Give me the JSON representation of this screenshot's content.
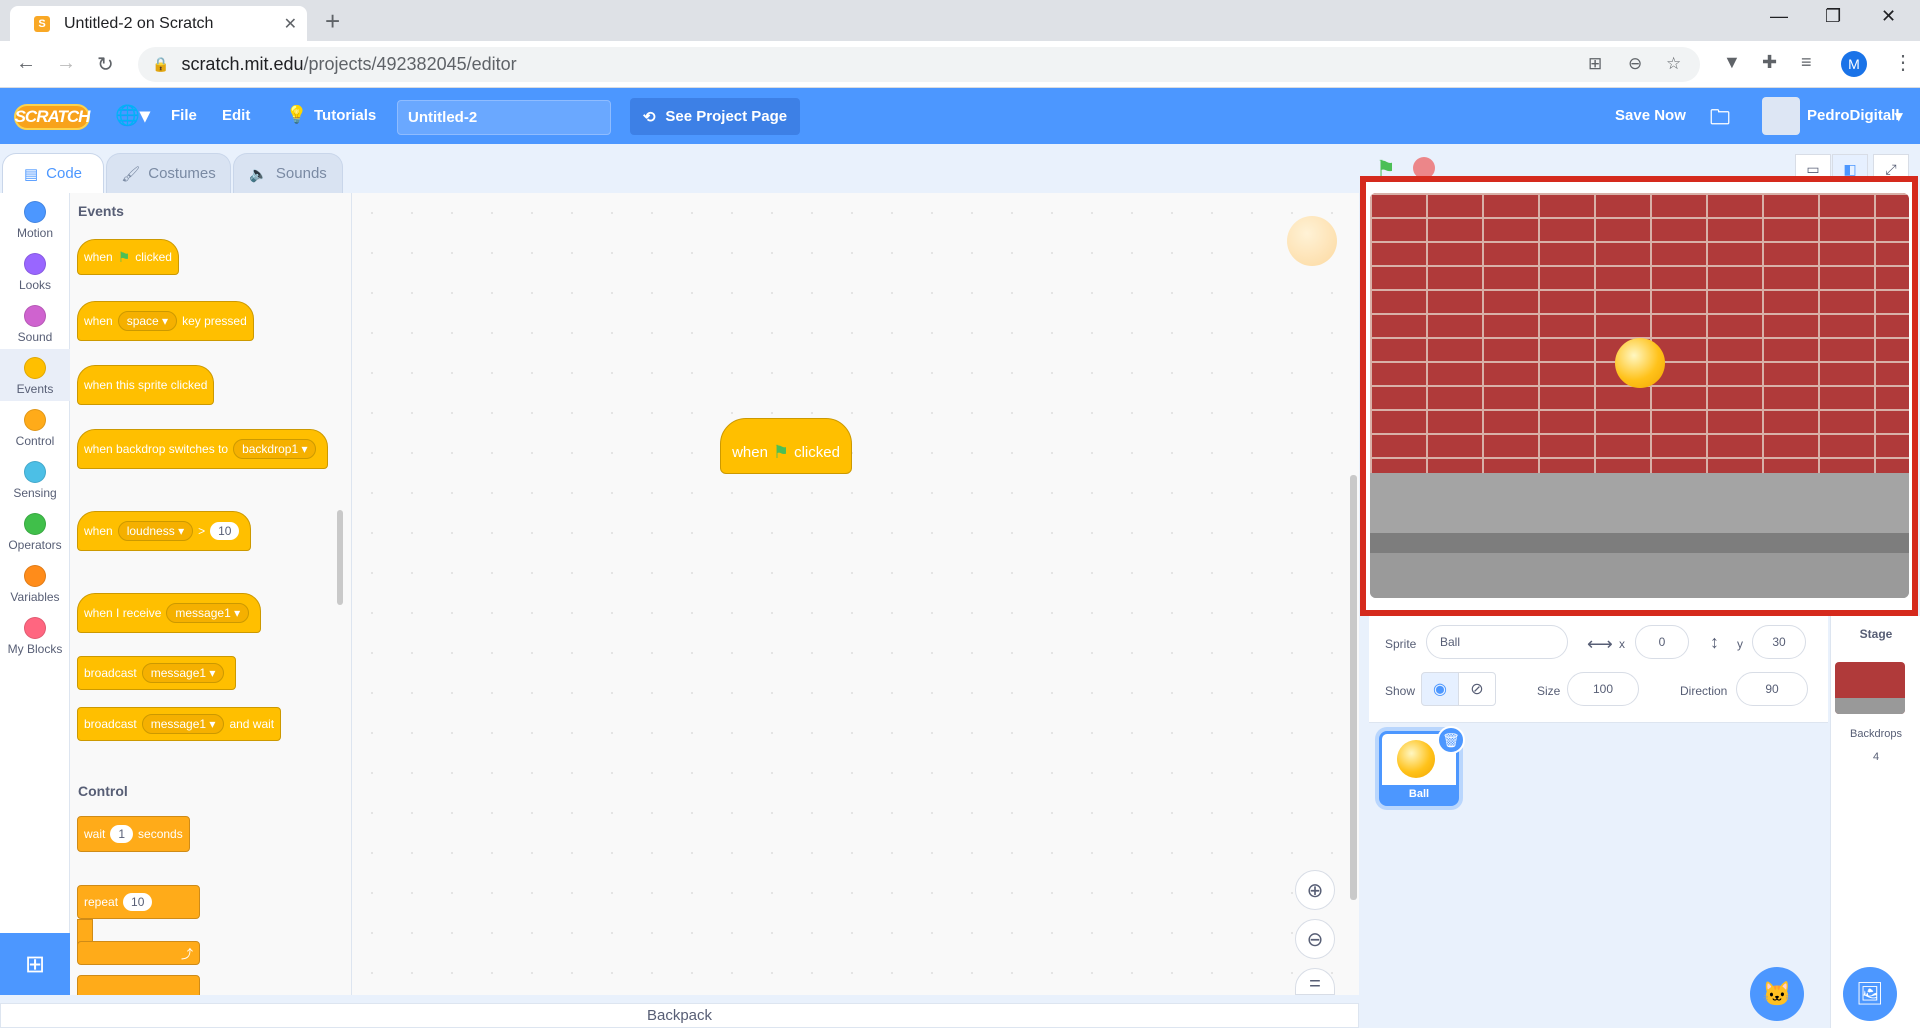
{
  "browser": {
    "tab_title": "Untitled-2 on Scratch",
    "favicon": "S",
    "url_domain": "scratch.mit.edu",
    "url_path": "/projects/492382045/editor",
    "profile_initial": "M"
  },
  "menubar": {
    "logo": "SCRATCH",
    "file": "File",
    "edit": "Edit",
    "tutorials": "Tutorials",
    "project_title": "Untitled-2",
    "see_project": "See Project Page",
    "save_now": "Save Now",
    "username": "PedroDigitall"
  },
  "tabs": {
    "code": "Code",
    "costumes": "Costumes",
    "sounds": "Sounds"
  },
  "categories": [
    {
      "label": "Motion",
      "color": "#4c97ff"
    },
    {
      "label": "Looks",
      "color": "#9966ff"
    },
    {
      "label": "Sound",
      "color": "#cf63cf"
    },
    {
      "label": "Events",
      "color": "#ffbf00"
    },
    {
      "label": "Control",
      "color": "#ffab19"
    },
    {
      "label": "Sensing",
      "color": "#4cbfe6"
    },
    {
      "label": "Operators",
      "color": "#40bf4a"
    },
    {
      "label": "Variables",
      "color": "#ff8c1a"
    },
    {
      "label": "My Blocks",
      "color": "#ff6680"
    }
  ],
  "palette": {
    "events_heading": "Events",
    "control_heading": "Control",
    "when": "when",
    "clicked": "clicked",
    "space": "space",
    "key_pressed": "key pressed",
    "sprite_clicked": "when this sprite clicked",
    "backdrop_switches": "when backdrop switches to",
    "backdrop1": "backdrop1",
    "loudness": "loudness",
    "gt": ">",
    "ten": "10",
    "receive": "when I receive",
    "message1": "message1",
    "broadcast": "broadcast",
    "and_wait": "and wait",
    "wait": "wait",
    "one": "1",
    "seconds": "seconds",
    "repeat": "repeat"
  },
  "workspace": {
    "when": "when",
    "clicked": "clicked"
  },
  "backpack": "Backpack",
  "sprite_info": {
    "sprite_label": "Sprite",
    "sprite_name": "Ball",
    "x_label": "x",
    "x_value": "0",
    "y_label": "y",
    "y_value": "30",
    "show_label": "Show",
    "size_label": "Size",
    "size_value": "100",
    "direction_label": "Direction",
    "direction_value": "90"
  },
  "sprite_list": [
    {
      "name": "Ball"
    }
  ],
  "stage_panel": {
    "label": "Stage",
    "backdrops_label": "Backdrops",
    "backdrops_count": "4"
  }
}
